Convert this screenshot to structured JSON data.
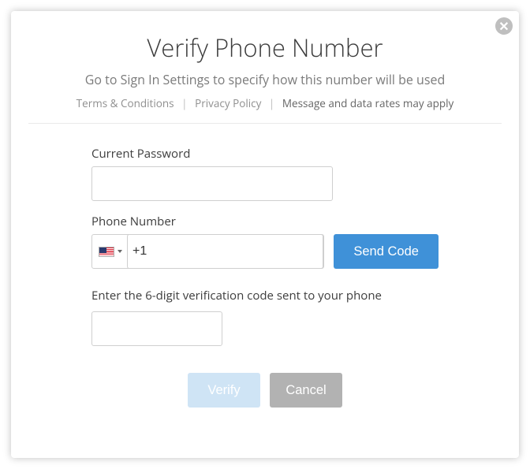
{
  "header": {
    "title": "Verify Phone Number",
    "subtitle": "Go to Sign In Settings to specify how this number will be used",
    "terms": "Terms & Conditions",
    "privacy": "Privacy Policy",
    "rates": "Message and data rates may apply"
  },
  "form": {
    "password_label": "Current Password",
    "password_value": "",
    "phone_label": "Phone Number",
    "phone_prefix": "+1",
    "phone_value": "",
    "send_code": "Send Code",
    "code_instruction": "Enter the 6-digit verification code sent to your phone",
    "code_value": ""
  },
  "actions": {
    "verify": "Verify",
    "cancel": "Cancel"
  }
}
